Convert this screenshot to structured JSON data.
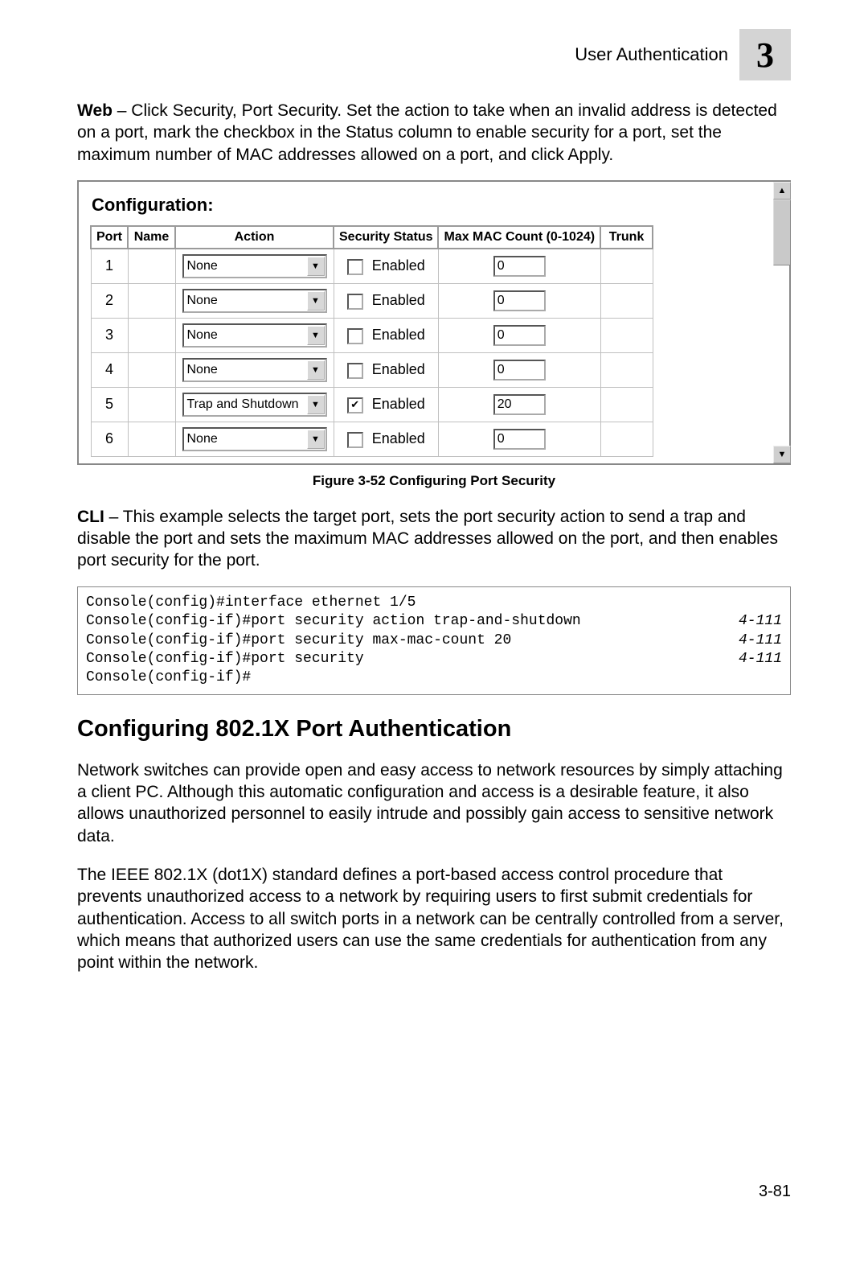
{
  "header": {
    "label": "User Authentication",
    "chapter": "3"
  },
  "web_para_lead": "Web",
  "web_para_body": " – Click Security, Port Security. Set the action to take when an invalid address is detected on a port, mark the checkbox in the Status column to enable security for a port, set the maximum number of MAC addresses allowed on a port, and click Apply.",
  "figure": {
    "title": "Configuration:",
    "headers": [
      "Port",
      "Name",
      "Action",
      "Security Status",
      "Max MAC Count (0-1024)",
      "Trunk"
    ],
    "enabled_label": "Enabled",
    "rows": [
      {
        "port": "1",
        "name": "",
        "action": "None",
        "checked": false,
        "max": "0",
        "trunk": ""
      },
      {
        "port": "2",
        "name": "",
        "action": "None",
        "checked": false,
        "max": "0",
        "trunk": ""
      },
      {
        "port": "3",
        "name": "",
        "action": "None",
        "checked": false,
        "max": "0",
        "trunk": ""
      },
      {
        "port": "4",
        "name": "",
        "action": "None",
        "checked": false,
        "max": "0",
        "trunk": ""
      },
      {
        "port": "5",
        "name": "",
        "action": "Trap and Shutdown",
        "checked": true,
        "max": "20",
        "trunk": ""
      },
      {
        "port": "6",
        "name": "",
        "action": "None",
        "checked": false,
        "max": "0",
        "trunk": ""
      }
    ]
  },
  "figure_caption": "Figure 3-52  Configuring Port Security",
  "cli_para_lead": "CLI",
  "cli_para_body": " – This example selects the target port, sets the port security action to send a trap and disable the port and sets the maximum MAC addresses allowed on the port, and then enables port security for the port.",
  "cli_lines": [
    {
      "cmd": "Console(config)#interface ethernet 1/5",
      "ref": ""
    },
    {
      "cmd": "Console(config-if)#port security action trap-and-shutdown",
      "ref": "4-111"
    },
    {
      "cmd": "Console(config-if)#port security max-mac-count 20",
      "ref": "4-111"
    },
    {
      "cmd": "Console(config-if)#port security",
      "ref": "4-111"
    },
    {
      "cmd": "Console(config-if)#",
      "ref": ""
    }
  ],
  "section_heading": "Configuring 802.1X Port Authentication",
  "body_para1": "Network switches can provide open and easy access to network resources by simply attaching a client PC. Although this automatic configuration and access is a desirable feature, it also allows unauthorized personnel to easily intrude and possibly gain access to sensitive network data.",
  "body_para2": "The IEEE 802.1X (dot1X) standard defines a port-based access control procedure that prevents unauthorized access to a network by requiring users to first submit credentials for authentication. Access to all switch ports in a network can be centrally controlled from a server, which means that authorized users can use the same credentials for authentication from any point within the network.",
  "page_number": "3-81"
}
